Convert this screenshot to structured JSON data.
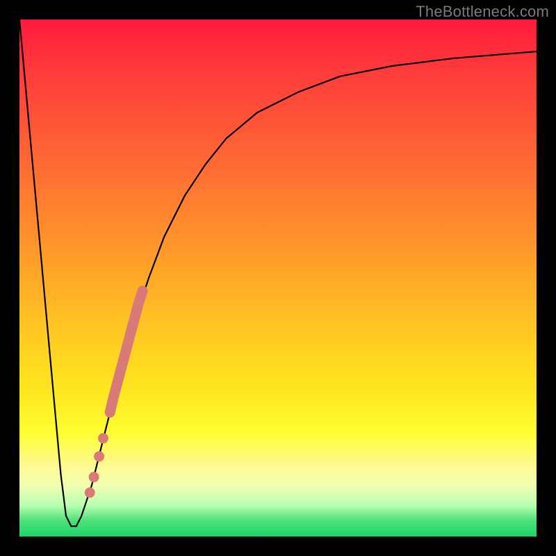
{
  "watermark": {
    "text": "TheBottleneck.com"
  },
  "colors": {
    "frame": "#000000",
    "curve": "#000000",
    "marker": "#d97a78",
    "gradient_stops": [
      "#ff1a3c",
      "#ff3b3b",
      "#ff6a33",
      "#ff9a2a",
      "#ffc722",
      "#ffe71f",
      "#ffff33",
      "#fff98e",
      "#f2ffb0",
      "#b8ffb0",
      "#4de07a",
      "#1ad66b"
    ]
  },
  "chart_data": {
    "type": "line",
    "title": "",
    "xlabel": "",
    "ylabel": "",
    "xlim": [
      0,
      100
    ],
    "ylim": [
      0,
      100
    ],
    "series": [
      {
        "name": "bottleneck-curve",
        "x": [
          0,
          2,
          4,
          6,
          8,
          9,
          10,
          11,
          12,
          14,
          16,
          18,
          20,
          22,
          25,
          28,
          32,
          36,
          40,
          46,
          54,
          62,
          72,
          84,
          100
        ],
        "y": [
          100,
          78,
          56,
          34,
          12,
          4,
          2,
          2,
          4,
          10,
          18,
          26,
          34,
          41,
          50,
          58,
          66,
          72,
          77,
          82,
          86,
          89,
          91,
          92.5,
          93.8
        ]
      }
    ],
    "markers": [
      {
        "name": "highlight-segment",
        "shape": "round-dots",
        "x": [
          17.5,
          18.2,
          19.0,
          19.8,
          20.6,
          21.4,
          22.2,
          23.0,
          23.8
        ],
        "y": [
          24.0,
          27.0,
          30.0,
          33.0,
          36.0,
          39.0,
          42.0,
          45.0,
          47.5
        ]
      },
      {
        "name": "dot-1",
        "shape": "dot",
        "x": 16.2,
        "y": 19.0
      },
      {
        "name": "dot-2",
        "shape": "dot",
        "x": 15.4,
        "y": 15.5
      },
      {
        "name": "dot-3",
        "shape": "dot",
        "x": 14.4,
        "y": 11.5
      },
      {
        "name": "dot-4",
        "shape": "dot",
        "x": 13.6,
        "y": 8.5
      }
    ]
  }
}
